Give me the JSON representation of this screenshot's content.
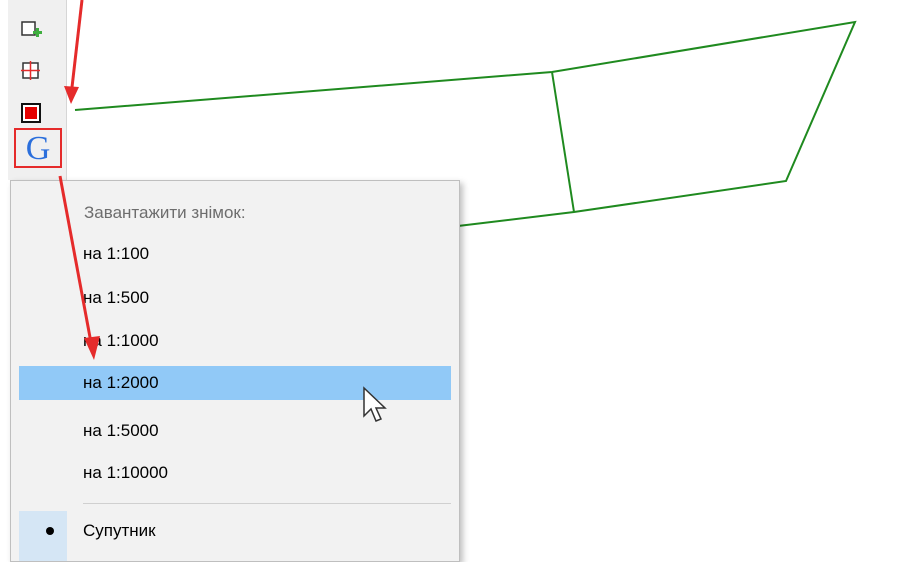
{
  "toolbar": {
    "tools": [
      {
        "icon": "add-square-icon"
      },
      {
        "icon": "crosshair-square-icon"
      },
      {
        "icon": "red-square-icon"
      },
      {
        "icon": "google-g-icon",
        "glyph": "G"
      }
    ]
  },
  "context_menu": {
    "header": "Завантажити знімок:",
    "items": [
      {
        "label": "на 1:100",
        "selected": false
      },
      {
        "label": "на 1:500",
        "selected": false
      },
      {
        "label": "на 1:1000",
        "selected": false
      },
      {
        "label": "на 1:2000",
        "selected": true
      },
      {
        "label": "на 1:5000",
        "selected": false
      },
      {
        "label": "на 1:10000",
        "selected": false
      }
    ],
    "radio_item": {
      "label": "Супутник",
      "checked": true
    }
  },
  "colors": {
    "polygon_line": "#1f8a1f",
    "annotation_red": "#e52b2b",
    "selection": "#91c9f7",
    "menu_bg": "#f2f2f2"
  }
}
